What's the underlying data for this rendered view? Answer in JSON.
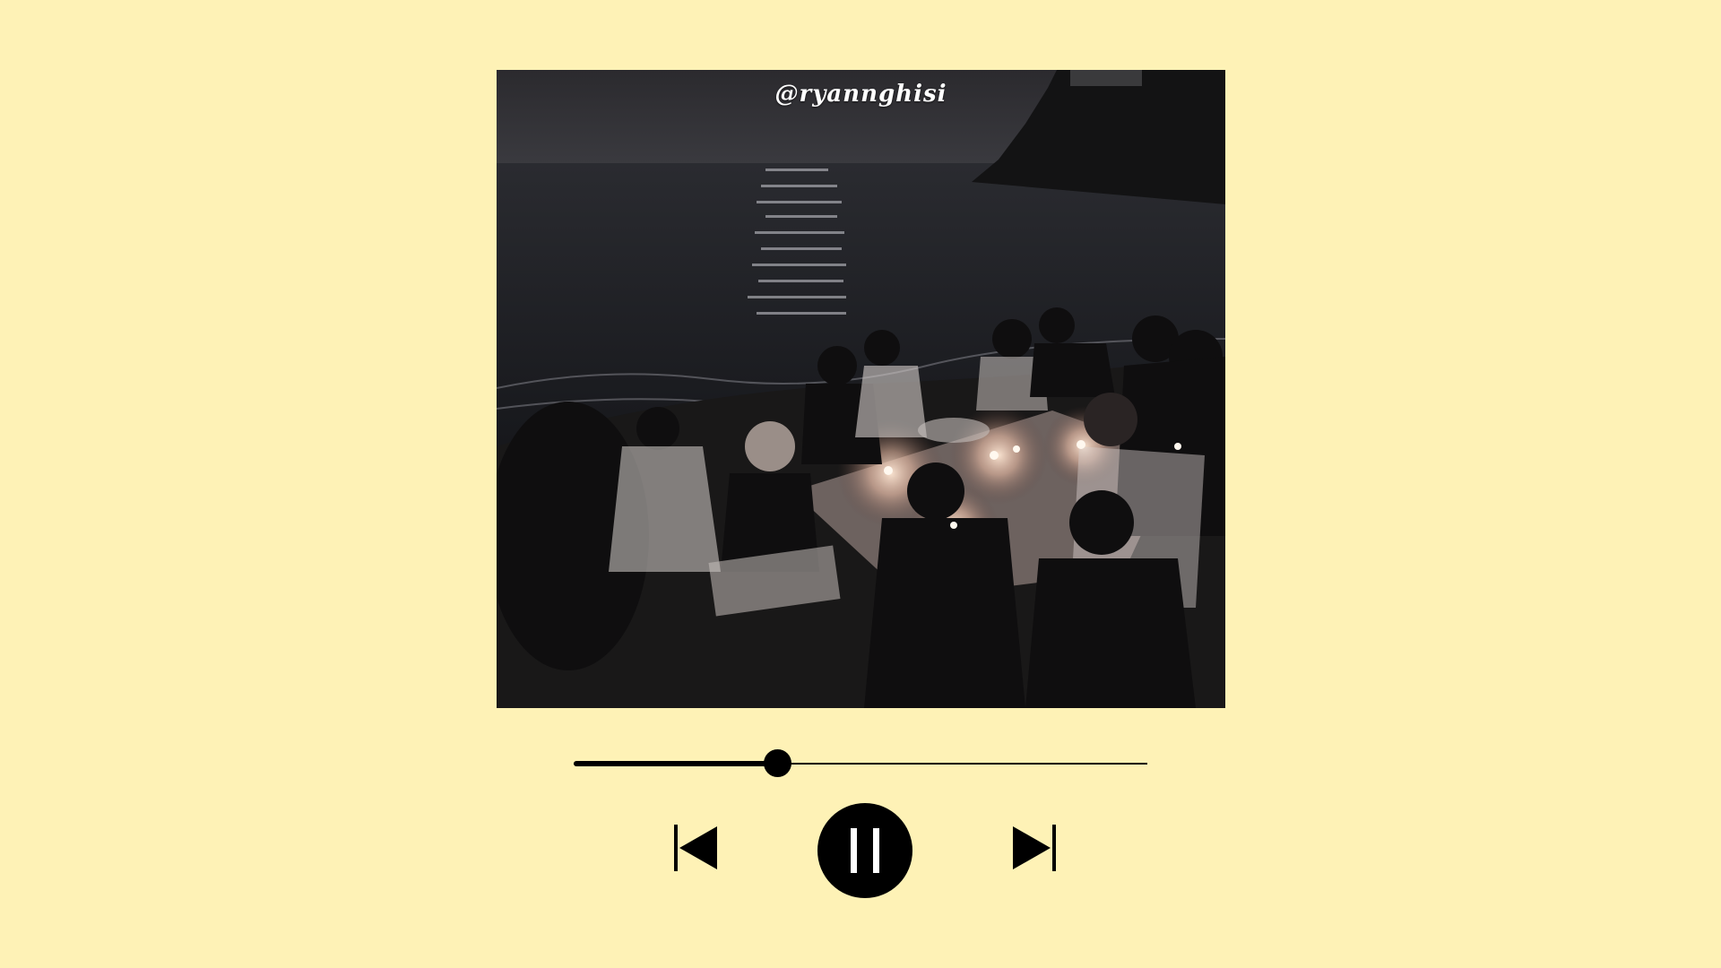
{
  "cover": {
    "watermark": "@ryannghisi"
  },
  "player": {
    "progress": 0.355,
    "controls": {
      "previous_icon": "skip-previous-icon",
      "pause_icon": "pause-icon",
      "next_icon": "skip-next-icon"
    }
  },
  "colors": {
    "background": "#FEF2B6",
    "controls": "#000000"
  }
}
